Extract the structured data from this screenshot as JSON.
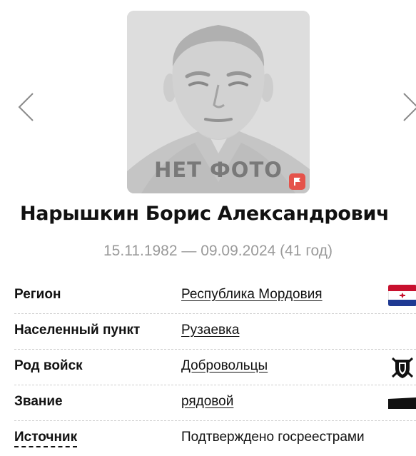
{
  "carousel": {
    "prev_icon": "chevron-left-icon",
    "next_icon": "chevron-right-icon"
  },
  "photo": {
    "placeholder_label": "НЕТ ФОТО",
    "flag_icon": "flag-icon",
    "flag_color": "#e5534b"
  },
  "person": {
    "name": "Нарышкин Борис Александрович",
    "dates": "15.11.1982 — 09.09.2024 (41 год)"
  },
  "info": {
    "rows": [
      {
        "label": "Регион",
        "value": "Республика Мордовия",
        "icon": "mordovia-flag-icon"
      },
      {
        "label": "Населенный пункт",
        "value": "Рузаевка"
      },
      {
        "label": "Род войск",
        "value": "Добровольцы",
        "icon": "volunteers-emblem-icon"
      },
      {
        "label": "Звание",
        "value": "рядовой",
        "icon": "rank-insignia-icon"
      },
      {
        "label": "Источник",
        "value": "Подтверждено госреестрами"
      }
    ]
  },
  "colors": {
    "dates_text": "#9a9a9a",
    "divider": "#cfcfcf",
    "flag_red": "#c8102e",
    "flag_blue": "#1f3a93"
  }
}
